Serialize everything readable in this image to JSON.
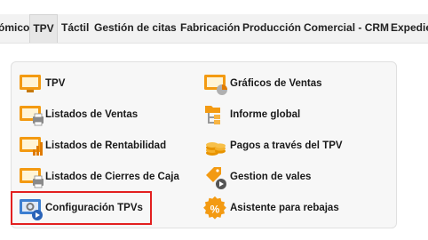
{
  "menubar": {
    "items": [
      "ómico",
      "TPV",
      "Táctil",
      "Gestión de citas",
      "Fabricación",
      "Producción",
      "Comercial - CRM",
      "Expedie"
    ],
    "active_index": 1
  },
  "menu": {
    "left": [
      {
        "label": "TPV",
        "icon": "monitor-icon"
      },
      {
        "label": "Listados de Ventas",
        "icon": "monitor-printer-icon"
      },
      {
        "label": "Listados de Rentabilidad",
        "icon": "monitor-bar-chart-icon"
      },
      {
        "label": "Listados de Cierres de Caja",
        "icon": "monitor-printer-icon"
      },
      {
        "label": "Configuración TPVs",
        "icon": "monitor-gear-play-icon"
      }
    ],
    "right": [
      {
        "label": "Gráficos de Ventas",
        "icon": "monitor-pie-chart-icon"
      },
      {
        "label": "Informe global",
        "icon": "folder-tree-icon"
      },
      {
        "label": "Pagos a través del TPV",
        "icon": "coins-icon"
      },
      {
        "label": "Gestion de vales",
        "icon": "price-tag-play-icon"
      },
      {
        "label": "Asistente para rebajas",
        "icon": "percent-badge-icon"
      }
    ]
  },
  "colors": {
    "icon_orange": "#f39a12",
    "icon_blue": "#3d7fd1",
    "highlight_red": "#e21f1f"
  }
}
